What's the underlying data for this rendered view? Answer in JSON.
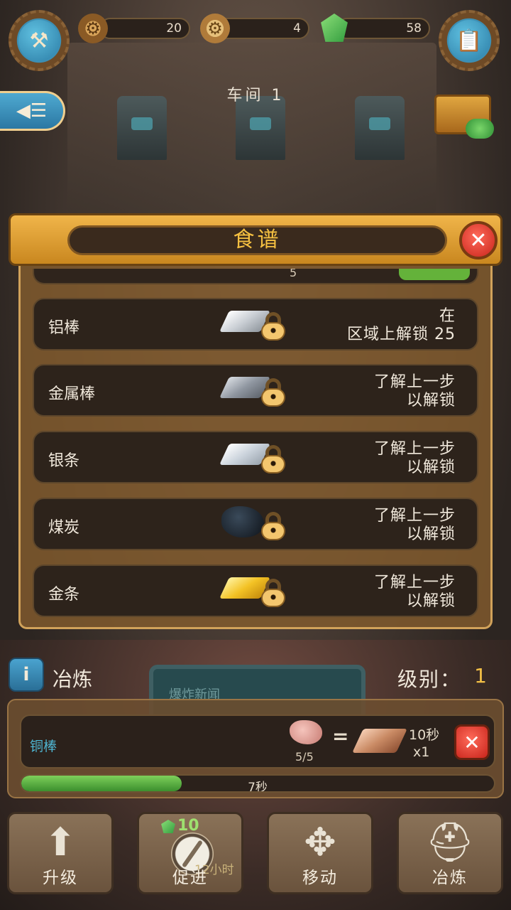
{
  "hud": {
    "gears": "20",
    "coins": "4",
    "gems": "58",
    "toolbox_icon": "toolbox-icon",
    "tasks_icon": "clipboard-icon"
  },
  "workshop": {
    "title": "车间 1"
  },
  "recipe_dialog": {
    "title": "食谱",
    "partial_row_value": "5",
    "rows": [
      {
        "name": "铝棒",
        "lock_line1": "在",
        "lock_line2": "区域上解锁 25",
        "item": "aluminum-bar"
      },
      {
        "name": "金属棒",
        "lock_line1": "了解上一步",
        "lock_line2": "以解锁",
        "item": "metal-bar"
      },
      {
        "name": "银条",
        "lock_line1": "了解上一步",
        "lock_line2": "以解锁",
        "item": "silver-bar"
      },
      {
        "name": "煤炭",
        "lock_line1": "了解上一步",
        "lock_line2": "以解锁",
        "item": "coal"
      },
      {
        "name": "金条",
        "lock_line1": "了解上一步",
        "lock_line2": "以解锁",
        "item": "gold-bar"
      }
    ]
  },
  "background_screen_text": "爆炸新闻",
  "smelting": {
    "info_label": "i",
    "title": "冶炼",
    "level_label": "级别：",
    "level_value": "1",
    "job": {
      "name": "铜棒",
      "input_count": "5/5",
      "equals": "=",
      "duration": "10秒",
      "quantity": "x1"
    },
    "progress": {
      "fraction": 0.34,
      "label": "7秒"
    }
  },
  "actions": {
    "upgrade": "升级",
    "boost": "促进",
    "boost_cost": "10",
    "boost_time": "12小时",
    "move": "移动",
    "smelt": "冶炼"
  },
  "colors": {
    "accent_gold": "#f5c041",
    "button_blue": "#3c8fb4",
    "progress_green": "#5fb845",
    "close_red": "#d9342a"
  }
}
